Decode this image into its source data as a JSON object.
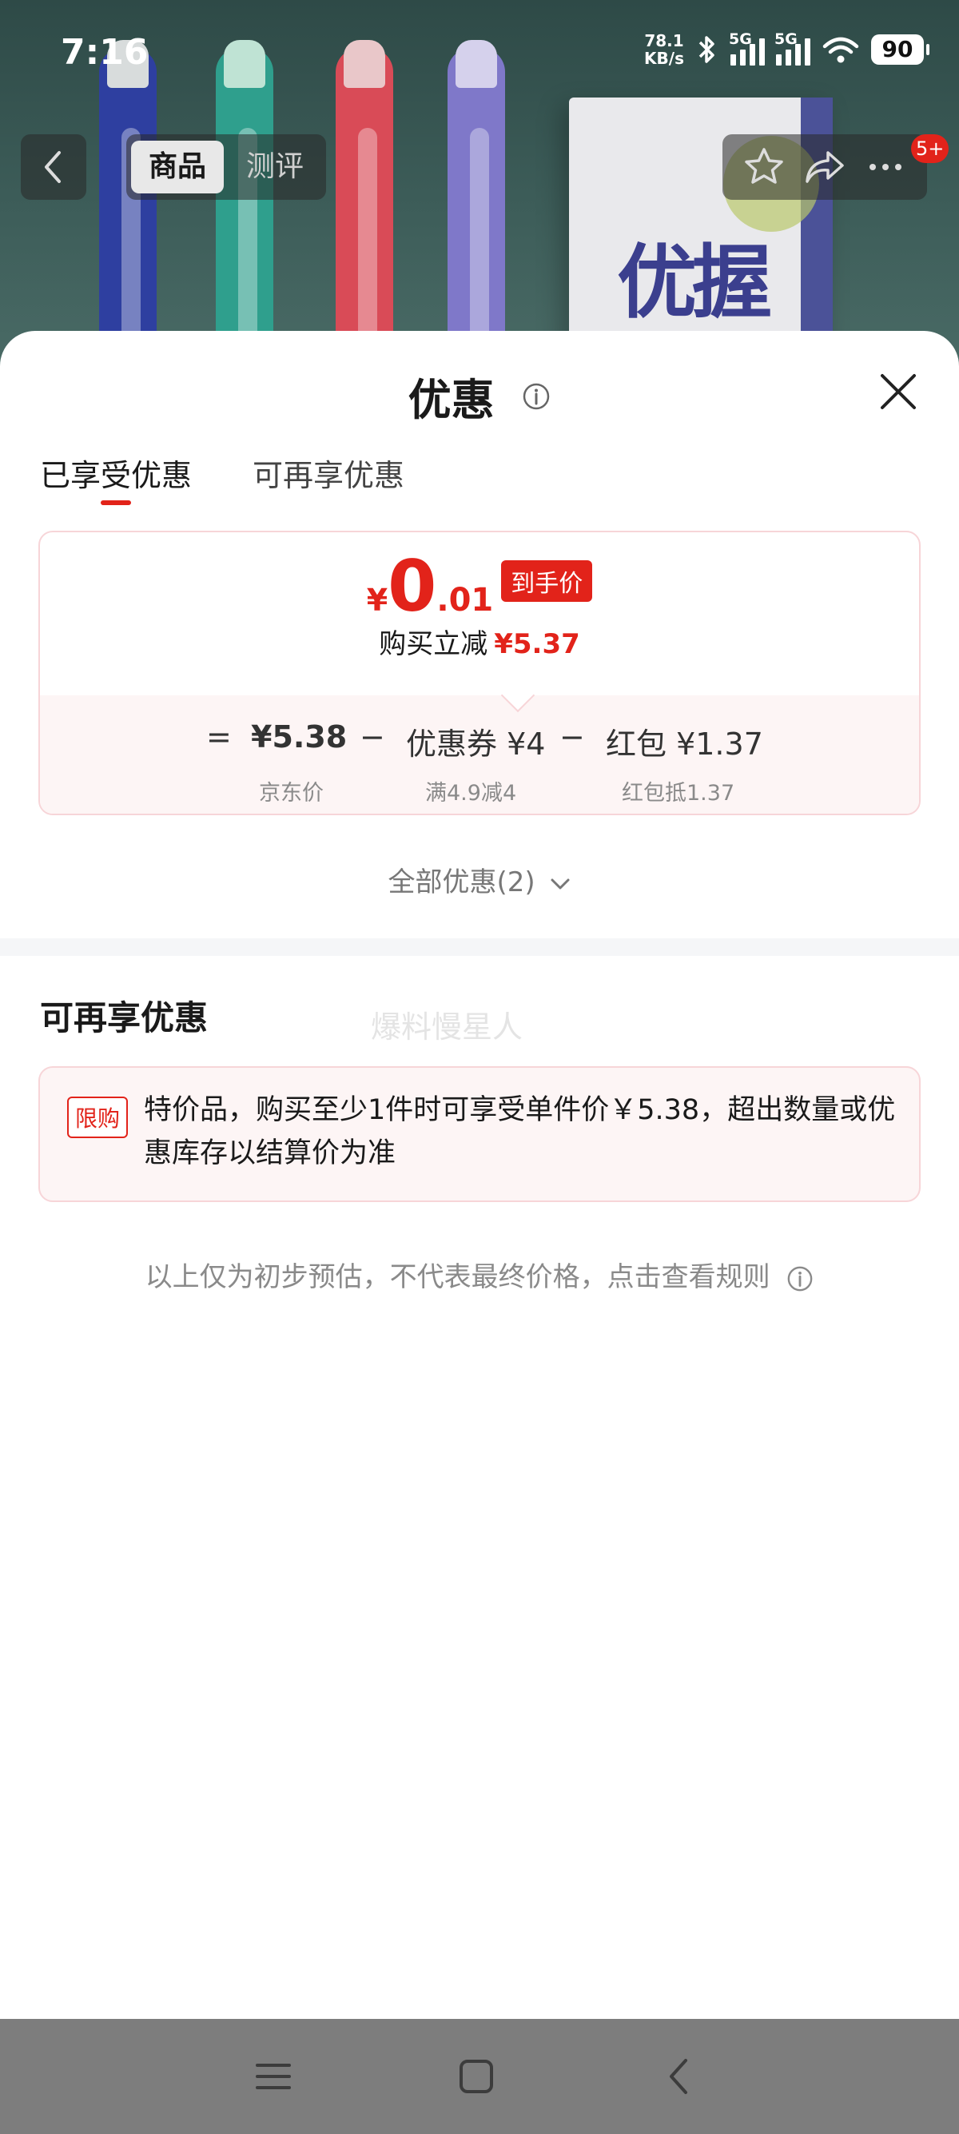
{
  "status_bar": {
    "time": "7:16",
    "net_speed_value": "78.1",
    "net_speed_unit": "KB/s",
    "signal1_label": "5G",
    "signal2_label": "5G",
    "battery": "90"
  },
  "nav": {
    "tab_product": "商品",
    "tab_review": "测评",
    "cart_badge": "5+"
  },
  "sheet": {
    "title": "优惠",
    "tabs": [
      {
        "label": "已享受优惠",
        "active": true
      },
      {
        "label": "可再享优惠",
        "active": false
      }
    ],
    "price": {
      "currency": "¥",
      "integer": "0",
      "decimal": ".01",
      "tag": "到手价",
      "save_label": "购买立减",
      "save_amount": "¥5.37"
    },
    "formula": {
      "equals": "=",
      "jd_price": "¥5.38",
      "jd_price_label": "京东价",
      "minus1": "−",
      "coupon": "优惠券 ¥4",
      "coupon_label": "满4.9减4",
      "minus2": "−",
      "red_packet": "红包 ¥1.37",
      "red_packet_label": "红包抵1.37"
    },
    "all_deals": "全部优惠(2)",
    "section_title": "可再享优惠",
    "watermark": "爆料慢星人",
    "limit": {
      "tag": "限购",
      "text": "特价品，购买至少1件时可享受单件价￥5.38，超出数量或优惠库存以结算价为准"
    },
    "disclaimer": "以上仅为初步预估，不代表最终价格，点击查看规则"
  },
  "product_image": {
    "brand_text": "优握"
  },
  "colors": {
    "accent_red": "#e2231a",
    "card_border": "#f7d5d8",
    "card_bg": "#fdf5f5",
    "system_nav_bg": "#7d7d7d"
  }
}
